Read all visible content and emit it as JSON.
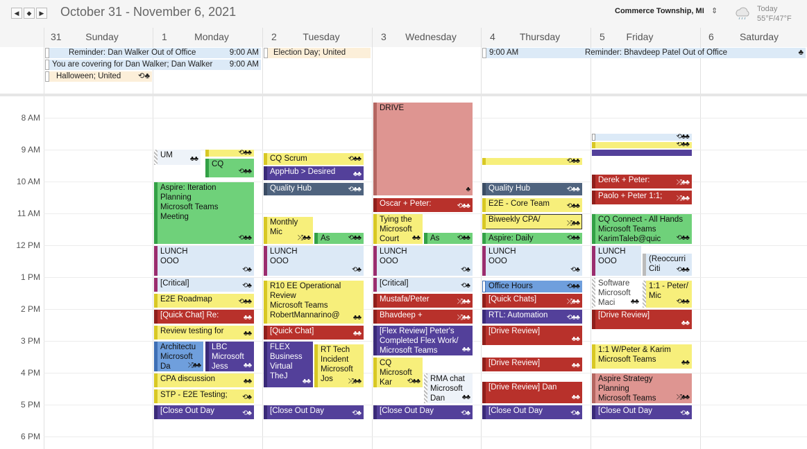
{
  "header": {
    "date_range": "October 31 - November 6, 2021",
    "location": "Commerce Township, MI",
    "today_label": "Today",
    "temperature": "55°F/47°F",
    "nav_prev": "◀",
    "nav_today": "◆",
    "nav_next": "▶",
    "location_chevron": "⌃⌄"
  },
  "days": [
    {
      "num": "31",
      "name": "Sunday"
    },
    {
      "num": "1",
      "name": "Monday"
    },
    {
      "num": "2",
      "name": "Tuesday"
    },
    {
      "num": "3",
      "name": "Wednesday"
    },
    {
      "num": "4",
      "name": "Thursday"
    },
    {
      "num": "5",
      "name": "Friday"
    },
    {
      "num": "6",
      "name": "Saturday"
    }
  ],
  "time_labels": [
    "8 AM",
    "9 AM",
    "10 AM",
    "11 AM",
    "12 PM",
    "1 PM",
    "2 PM",
    "3 PM",
    "4 PM",
    "5 PM",
    "6 PM"
  ],
  "all_day": [
    {
      "text": "Reminder: Dan Walker Out of Office",
      "time": "9:00 AM"
    },
    {
      "text": "You are covering for Dan Walker; Dan Walker",
      "time": "9:00 AM"
    },
    {
      "text": "Halloween; United",
      "icons": "⟲♣"
    },
    {
      "text": "Election Day; United"
    },
    {
      "text": "9:00 AM",
      "text2": "Reminder: Bhavdeep Patel Out of Office",
      "icons": "♣"
    }
  ],
  "events": [
    {
      "l1": "UM",
      "icons": "♣♣"
    },
    {
      "l1": "",
      "icons": "⟲♣♣"
    },
    {
      "l1": "CQ",
      "icons": "⟲♣♣"
    },
    {
      "l1": "Aspire: Iteration",
      "l2": "Planning",
      "l3": "Microsoft Teams",
      "l4": "Meeting",
      "icons": "⟲♣♣"
    },
    {
      "l1": "LUNCH",
      "l2": "OOO",
      "icons": "⟲♣"
    },
    {
      "l1": "[Critical]",
      "icons": "⟲♣"
    },
    {
      "l1": "E2E Roadmap",
      "icons": "⟲♣♣"
    },
    {
      "l1": "[Quick Chat] Re:",
      "icons": "♣♣"
    },
    {
      "l1": "Review testing for",
      "icons": "♣♣"
    },
    {
      "l1": "Architectu",
      "l2": "Microsoft",
      "l3": "Da",
      "icons": "⤮♣♣"
    },
    {
      "l1": "LBC",
      "l2": "Microsoft",
      "l3": "Jess",
      "icons": "♣♣"
    },
    {
      "l1": "CPA discussion",
      "icons": "♣♣"
    },
    {
      "l1": "STP - E2E Testing;",
      "icons": "⟲♣"
    },
    {
      "l1": "[Close Out Day",
      "icons": "⟲♣"
    },
    {
      "l1": "CQ Scrum",
      "icons": "⟲♣♣"
    },
    {
      "l1": "AppHub > Desired",
      "icons": "♣♣"
    },
    {
      "l1": "Quality Hub",
      "icons": "⟲♣♣"
    },
    {
      "l1": "Monthly",
      "l2": "Mic",
      "icons": "⤮♣♣"
    },
    {
      "l1": "As",
      "icons": "⟲♣♣"
    },
    {
      "l1": "LUNCH",
      "l2": "OOO",
      "icons": "⟲♣"
    },
    {
      "l1": "R10 EE Operational",
      "l2": "Review",
      "l3": "Microsoft Teams",
      "l4": "RobertMannarino@",
      "icons": "♣♣"
    },
    {
      "l1": "[Quick Chat]",
      "icons": "♣♣"
    },
    {
      "l1": "FLEX",
      "l2": "Business",
      "l3": "Virtual",
      "l4": "TheJ",
      "icons": "♣♣"
    },
    {
      "l1": "RT Tech",
      "l2": "Incident",
      "l3": "Microsoft",
      "l4": "Jos",
      "icons": "⤮♣♣"
    },
    {
      "l1": "[Close Out Day",
      "icons": "⟲♣"
    },
    {
      "l1": "DRIVE",
      "icons": "♣"
    },
    {
      "l1": "Oscar + Peter:",
      "icons": "⟲♣♣"
    },
    {
      "l1": "Tying the",
      "l2": "Microsoft",
      "l3": "Court",
      "icons": "♣♣"
    },
    {
      "l1": "As",
      "icons": "⟲♣♣"
    },
    {
      "l1": "LUNCH",
      "l2": "OOO",
      "icons": "⟲♣"
    },
    {
      "l1": "[Critical]",
      "icons": "⟲♣"
    },
    {
      "l1": "Mustafa/Peter",
      "icons": "⤮♣♣"
    },
    {
      "l1": "Bhavdeep +",
      "icons": "⤮♣♣"
    },
    {
      "l1": "[Flex Review] Peter's",
      "l2": "Completed Flex Work/",
      "l3": "Microsoft Teams",
      "icons": "♣♣"
    },
    {
      "l1": "CQ",
      "l2": "Microsoft",
      "l3": "Kar",
      "icons": "⟲♣♣"
    },
    {
      "l1": "RMA chat",
      "l2": "Microsoft",
      "l3": "Dan",
      "icons": "♣♣"
    },
    {
      "l1": "[Close Out Day",
      "icons": "⟲♣"
    },
    {
      "l1": "",
      "icons": "⟲♣♣"
    },
    {
      "l1": "Quality Hub",
      "icons": "⟲♣♣"
    },
    {
      "l1": "E2E - Core Team",
      "icons": "⟲♣♣"
    },
    {
      "l1": "Biweekly CPA/",
      "icons": "⤮♣♣"
    },
    {
      "l1": "Aspire: Daily",
      "icons": "⟲♣♣"
    },
    {
      "l1": "LUNCH",
      "l2": "OOO",
      "icons": "⟲♣"
    },
    {
      "l1": "Office Hours",
      "icons": "⟲♣♣"
    },
    {
      "l1": "[Quick Chats]",
      "icons": "⤮♣♣"
    },
    {
      "l1": "RTL: Automation",
      "icons": "⟲♣♣"
    },
    {
      "l1": "[Drive Review]",
      "icons": "♣♣"
    },
    {
      "l1": "[Drive Review]",
      "icons": "♣♣"
    },
    {
      "l1": "[Drive Review] Dan",
      "icons": "♣♣"
    },
    {
      "l1": "[Close Out Day",
      "icons": "⟲♣"
    },
    {
      "l1": "",
      "icons": "⟲♣♣"
    },
    {
      "l1": "",
      "icons": "⟲♣♣"
    },
    {
      "l1": "Derek + Peter:",
      "icons": "⤮♣♣"
    },
    {
      "l1": "Paolo + Peter 1:1;",
      "icons": "⤮♣♣"
    },
    {
      "l1": "CQ Connect - All Hands",
      "l2": "Microsoft Teams",
      "l3": "KarimTaleb@quic",
      "icons": "⟲♣♣"
    },
    {
      "l1": "LUNCH",
      "l2": "OOO",
      "icons": ""
    },
    {
      "l1": "(Reoccurri",
      "l2": "Citi",
      "icons": "⟲♣♣"
    },
    {
      "l1": "Software",
      "l2": "Microsoft",
      "l3": "Maci",
      "icons": "♣♣"
    },
    {
      "l1": "1:1 - Peter/",
      "l2": "Mic",
      "icons": "⟲♣♣"
    },
    {
      "l1": "[Drive Review]",
      "icons": "♣♣"
    },
    {
      "l1": "1:1 W/Peter & Karim",
      "l2": "Microsoft Teams",
      "icons": "♣♣"
    },
    {
      "l1": "Aspire Strategy",
      "l2": "Planning",
      "l3": "Microsoft Teams",
      "icons": "⤮♣♣"
    },
    {
      "l1": "[Close Out Day",
      "icons": "⟲♣"
    }
  ]
}
